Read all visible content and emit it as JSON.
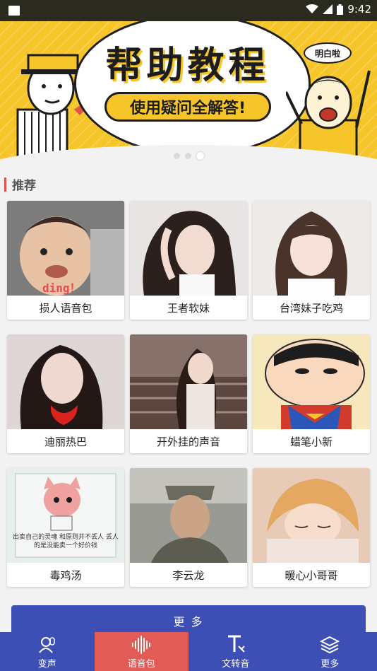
{
  "status_bar": {
    "time": "9:42"
  },
  "banner": {
    "title": "帮助教程",
    "subtitle": "使用疑问全解答!",
    "speech_bubble": "明白啦",
    "page_dots": 3,
    "active_dot": 2
  },
  "section": {
    "title": "推荐"
  },
  "cards": [
    {
      "label": "损人语音包",
      "overlay": "ding！"
    },
    {
      "label": "王者软妹"
    },
    {
      "label": "台湾妹子吃鸡"
    },
    {
      "label": "迪丽热巴"
    },
    {
      "label": "开外挂的声音"
    },
    {
      "label": "蜡笔小新"
    },
    {
      "label": "毒鸡汤",
      "overlay": "出卖自己的灵魂 和原则并不丢人 丢人的是没能卖一个好价钱"
    },
    {
      "label": "李云龙"
    },
    {
      "label": "暖心小哥哥"
    }
  ],
  "more_button": "更 多",
  "nav": [
    {
      "label": "变声",
      "icon": "voice-change-icon"
    },
    {
      "label": "语音包",
      "icon": "waveform-icon",
      "active": true
    },
    {
      "label": "文转音",
      "icon": "text-to-speech-icon"
    },
    {
      "label": "更多",
      "icon": "layers-icon"
    }
  ],
  "colors": {
    "primary": "#3d4fb5",
    "accent": "#e25b57",
    "banner_yellow": "#f6c52a"
  }
}
